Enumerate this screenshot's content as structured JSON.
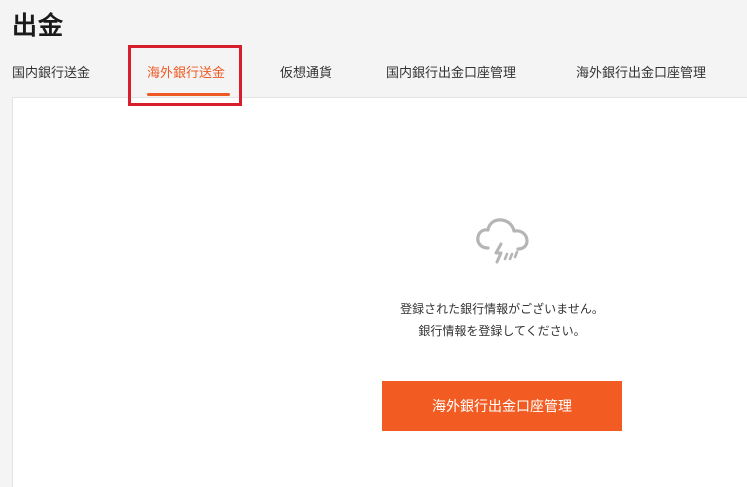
{
  "page": {
    "title": "出金"
  },
  "tabs": [
    {
      "label": "国内銀行送金",
      "active": false
    },
    {
      "label": "海外銀行送金",
      "active": true
    },
    {
      "label": "仮想通貨",
      "active": false
    },
    {
      "label": "国内銀行出金口座管理",
      "active": false
    },
    {
      "label": "海外銀行出金口座管理",
      "active": false
    }
  ],
  "empty_state": {
    "icon": "cloud-rain-icon",
    "line1": "登録された銀行情報がございません。",
    "line2": "銀行情報を登録してください。"
  },
  "actions": {
    "manage_label": "海外銀行出金口座管理"
  },
  "colors": {
    "accent": "#ee5a24",
    "button": "#f25c22",
    "highlight": "#d61f2b",
    "icon": "#b5b5b5"
  }
}
